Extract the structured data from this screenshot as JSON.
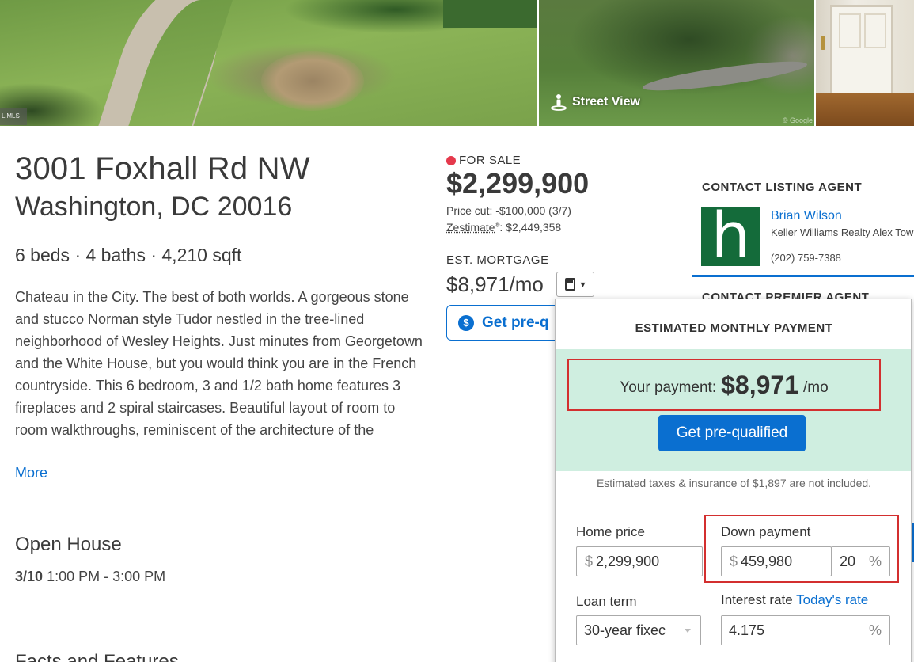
{
  "photos": {
    "mls_label": "L MLS",
    "street_view_label": "Street View",
    "google_credit": "© Google"
  },
  "listing": {
    "street": "3001 Foxhall Rd NW",
    "city_state_zip": "Washington, DC 20016",
    "facts": "6 beds · 4 baths · 4,210 sqft",
    "description": "Chateau in the City. The best of both worlds. A gorgeous stone and stucco Norman style Tudor nestled in the tree-lined neighborhood of Wesley Heights. Just minutes from Georgetown and the White House, but you would think you are in the French countryside. This 6 bedroom, 3 and 1/2 bath home features 3 fireplaces and 2 spiral staircases. Beautiful layout of room to room walkthroughs, reminiscent of the architecture of the",
    "more_link": "More",
    "open_house_title": "Open House",
    "open_house_date": "3/10",
    "open_house_time": "1:00 PM - 3:00 PM",
    "facts_features_title": "Facts and Features"
  },
  "price_block": {
    "status": "FOR SALE",
    "status_color": "#e5394c",
    "price": "$2,299,900",
    "price_cut": "Price cut: -$100,000 (3/7)",
    "zestimate_label": "Zestimate",
    "zestimate_mark": "®",
    "zestimate_value": ": $2,449,358",
    "mortgage_label": "EST. MORTGAGE",
    "mortgage_value": "$8,971/mo",
    "prequal_short": "Get pre-q",
    "dollar_icon": "$"
  },
  "agent": {
    "section_label": "CONTACT LISTING AGENT",
    "logo_letter": "h",
    "logo_color": "#146b3a",
    "name": "Brian Wilson",
    "company": "Keller Williams Realty Alex Town",
    "phone": "(202) 759-7388",
    "premier_label": "CONTACT PREMIER AGENT"
  },
  "popover": {
    "title": "ESTIMATED MONTHLY PAYMENT",
    "payment_label": "Your payment:",
    "payment_amount": "$8,971",
    "payment_unit": "/mo",
    "prequal_button": "Get pre-qualified",
    "tax_note": "Estimated taxes & insurance of $1,897 are not included.",
    "home_price_label": "Home price",
    "home_price_prefix": "$",
    "home_price_value": "2,299,900",
    "down_payment_label": "Down payment",
    "down_payment_prefix": "$",
    "down_payment_value": "459,980",
    "down_payment_percent": "20",
    "percent_sign": "%",
    "loan_term_label": "Loan term",
    "loan_term_value": "30-year fixec",
    "interest_rate_label": "Interest rate",
    "todays_rate_link": "Today's rate",
    "interest_rate_value": "4.175",
    "accent_color": "#0a6fd0",
    "highlight_color": "#d32f2f",
    "band_color": "#cfeee0"
  }
}
